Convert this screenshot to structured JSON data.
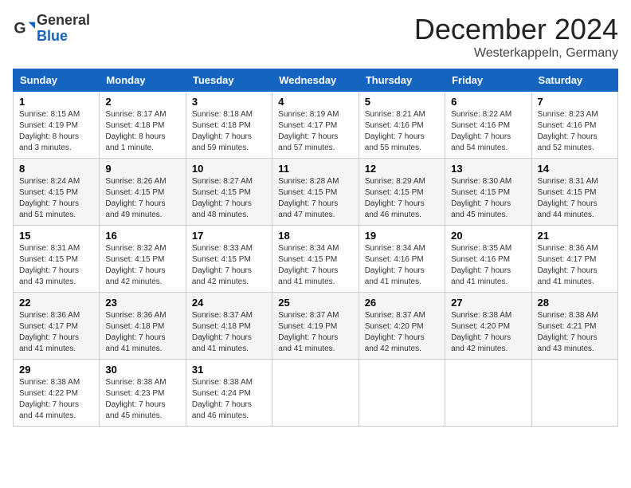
{
  "header": {
    "logo_general": "General",
    "logo_blue": "Blue",
    "month_title": "December 2024",
    "location": "Westerkappeln, Germany"
  },
  "weekdays": [
    "Sunday",
    "Monday",
    "Tuesday",
    "Wednesday",
    "Thursday",
    "Friday",
    "Saturday"
  ],
  "weeks": [
    [
      {
        "day": "1",
        "sunrise": "Sunrise: 8:15 AM",
        "sunset": "Sunset: 4:19 PM",
        "daylight": "Daylight: 8 hours and 3 minutes."
      },
      {
        "day": "2",
        "sunrise": "Sunrise: 8:17 AM",
        "sunset": "Sunset: 4:18 PM",
        "daylight": "Daylight: 8 hours and 1 minute."
      },
      {
        "day": "3",
        "sunrise": "Sunrise: 8:18 AM",
        "sunset": "Sunset: 4:18 PM",
        "daylight": "Daylight: 7 hours and 59 minutes."
      },
      {
        "day": "4",
        "sunrise": "Sunrise: 8:19 AM",
        "sunset": "Sunset: 4:17 PM",
        "daylight": "Daylight: 7 hours and 57 minutes."
      },
      {
        "day": "5",
        "sunrise": "Sunrise: 8:21 AM",
        "sunset": "Sunset: 4:16 PM",
        "daylight": "Daylight: 7 hours and 55 minutes."
      },
      {
        "day": "6",
        "sunrise": "Sunrise: 8:22 AM",
        "sunset": "Sunset: 4:16 PM",
        "daylight": "Daylight: 7 hours and 54 minutes."
      },
      {
        "day": "7",
        "sunrise": "Sunrise: 8:23 AM",
        "sunset": "Sunset: 4:16 PM",
        "daylight": "Daylight: 7 hours and 52 minutes."
      }
    ],
    [
      {
        "day": "8",
        "sunrise": "Sunrise: 8:24 AM",
        "sunset": "Sunset: 4:15 PM",
        "daylight": "Daylight: 7 hours and 51 minutes."
      },
      {
        "day": "9",
        "sunrise": "Sunrise: 8:26 AM",
        "sunset": "Sunset: 4:15 PM",
        "daylight": "Daylight: 7 hours and 49 minutes."
      },
      {
        "day": "10",
        "sunrise": "Sunrise: 8:27 AM",
        "sunset": "Sunset: 4:15 PM",
        "daylight": "Daylight: 7 hours and 48 minutes."
      },
      {
        "day": "11",
        "sunrise": "Sunrise: 8:28 AM",
        "sunset": "Sunset: 4:15 PM",
        "daylight": "Daylight: 7 hours and 47 minutes."
      },
      {
        "day": "12",
        "sunrise": "Sunrise: 8:29 AM",
        "sunset": "Sunset: 4:15 PM",
        "daylight": "Daylight: 7 hours and 46 minutes."
      },
      {
        "day": "13",
        "sunrise": "Sunrise: 8:30 AM",
        "sunset": "Sunset: 4:15 PM",
        "daylight": "Daylight: 7 hours and 45 minutes."
      },
      {
        "day": "14",
        "sunrise": "Sunrise: 8:31 AM",
        "sunset": "Sunset: 4:15 PM",
        "daylight": "Daylight: 7 hours and 44 minutes."
      }
    ],
    [
      {
        "day": "15",
        "sunrise": "Sunrise: 8:31 AM",
        "sunset": "Sunset: 4:15 PM",
        "daylight": "Daylight: 7 hours and 43 minutes."
      },
      {
        "day": "16",
        "sunrise": "Sunrise: 8:32 AM",
        "sunset": "Sunset: 4:15 PM",
        "daylight": "Daylight: 7 hours and 42 minutes."
      },
      {
        "day": "17",
        "sunrise": "Sunrise: 8:33 AM",
        "sunset": "Sunset: 4:15 PM",
        "daylight": "Daylight: 7 hours and 42 minutes."
      },
      {
        "day": "18",
        "sunrise": "Sunrise: 8:34 AM",
        "sunset": "Sunset: 4:15 PM",
        "daylight": "Daylight: 7 hours and 41 minutes."
      },
      {
        "day": "19",
        "sunrise": "Sunrise: 8:34 AM",
        "sunset": "Sunset: 4:16 PM",
        "daylight": "Daylight: 7 hours and 41 minutes."
      },
      {
        "day": "20",
        "sunrise": "Sunrise: 8:35 AM",
        "sunset": "Sunset: 4:16 PM",
        "daylight": "Daylight: 7 hours and 41 minutes."
      },
      {
        "day": "21",
        "sunrise": "Sunrise: 8:36 AM",
        "sunset": "Sunset: 4:17 PM",
        "daylight": "Daylight: 7 hours and 41 minutes."
      }
    ],
    [
      {
        "day": "22",
        "sunrise": "Sunrise: 8:36 AM",
        "sunset": "Sunset: 4:17 PM",
        "daylight": "Daylight: 7 hours and 41 minutes."
      },
      {
        "day": "23",
        "sunrise": "Sunrise: 8:36 AM",
        "sunset": "Sunset: 4:18 PM",
        "daylight": "Daylight: 7 hours and 41 minutes."
      },
      {
        "day": "24",
        "sunrise": "Sunrise: 8:37 AM",
        "sunset": "Sunset: 4:18 PM",
        "daylight": "Daylight: 7 hours and 41 minutes."
      },
      {
        "day": "25",
        "sunrise": "Sunrise: 8:37 AM",
        "sunset": "Sunset: 4:19 PM",
        "daylight": "Daylight: 7 hours and 41 minutes."
      },
      {
        "day": "26",
        "sunrise": "Sunrise: 8:37 AM",
        "sunset": "Sunset: 4:20 PM",
        "daylight": "Daylight: 7 hours and 42 minutes."
      },
      {
        "day": "27",
        "sunrise": "Sunrise: 8:38 AM",
        "sunset": "Sunset: 4:20 PM",
        "daylight": "Daylight: 7 hours and 42 minutes."
      },
      {
        "day": "28",
        "sunrise": "Sunrise: 8:38 AM",
        "sunset": "Sunset: 4:21 PM",
        "daylight": "Daylight: 7 hours and 43 minutes."
      }
    ],
    [
      {
        "day": "29",
        "sunrise": "Sunrise: 8:38 AM",
        "sunset": "Sunset: 4:22 PM",
        "daylight": "Daylight: 7 hours and 44 minutes."
      },
      {
        "day": "30",
        "sunrise": "Sunrise: 8:38 AM",
        "sunset": "Sunset: 4:23 PM",
        "daylight": "Daylight: 7 hours and 45 minutes."
      },
      {
        "day": "31",
        "sunrise": "Sunrise: 8:38 AM",
        "sunset": "Sunset: 4:24 PM",
        "daylight": "Daylight: 7 hours and 46 minutes."
      },
      null,
      null,
      null,
      null
    ]
  ]
}
